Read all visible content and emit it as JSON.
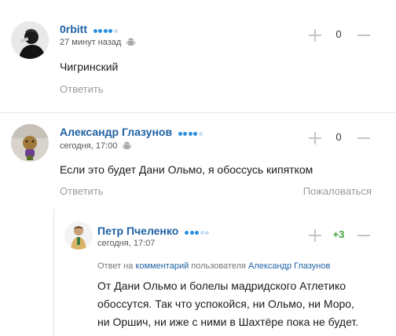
{
  "comments": [
    {
      "author": "0rbitt",
      "time": "27 минут назад",
      "text": "Чигринский",
      "reply_label": "Ответить",
      "score": "0",
      "device_icon": "android-icon"
    },
    {
      "author": "Александр Глазунов",
      "time": "сегодня, 17:00",
      "text": "Если это будет Дани Ольмо, я обоссусь кипятком",
      "reply_label": "Ответить",
      "report_label": "Пожаловаться",
      "score": "0",
      "device_icon": "android-icon"
    },
    {
      "author": "Петр Пчеленко",
      "time": "сегодня, 17:07",
      "reply_prefix": "Ответ на",
      "reply_link": "комментарий",
      "reply_middle": "пользователя",
      "reply_user": "Александр Глазунов",
      "text_lines": [
        "От Дани Ольмо и болелы мадридского Атлетико",
        "обоссутся. Так что успокойся, ни Ольмо, ни Моро,",
        "ни Оршич, ни иже с ними в Шахтёре пока не будет."
      ],
      "score": "+3"
    }
  ],
  "colors": {
    "author": "#1f61a3",
    "muted": "#9b9b9b",
    "positive": "#3ea33e",
    "rating_on": "#2a8fe0",
    "rating_off": "#c9dff2"
  }
}
